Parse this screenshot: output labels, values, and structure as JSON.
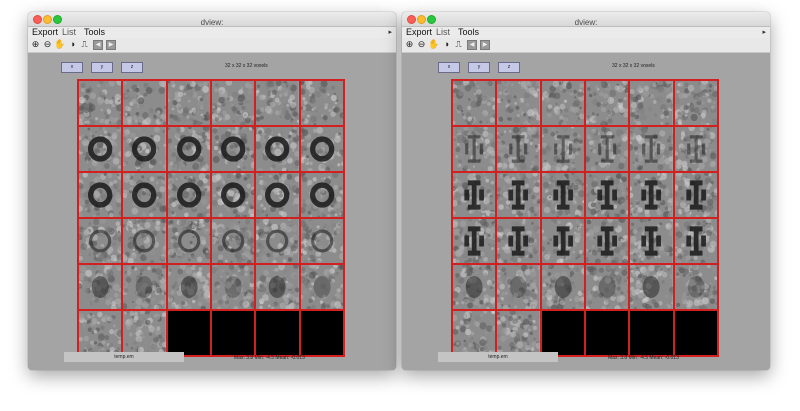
{
  "windows": [
    {
      "title": "dview:",
      "menu": [
        "Export",
        "List",
        "Tools"
      ],
      "menu_arrow": "▸",
      "tools": [
        "zoom-in-icon",
        "zoom-out-icon",
        "hand-icon",
        "contrast-icon",
        "step-icon",
        "back-icon",
        "forward-icon"
      ],
      "axis_buttons": [
        "x",
        "y",
        "z"
      ],
      "dims_label": "32 x 32 x 32 voxels",
      "grid": {
        "rows": 6,
        "cols": 6,
        "filled": 32
      },
      "file": "temp.em",
      "stats": "Max: 3.8   Min: -4.5   Mean: -0.013"
    },
    {
      "title": "dview:",
      "menu": [
        "Export",
        "List",
        "Tools"
      ],
      "menu_arrow": "▸",
      "tools": [
        "zoom-in-icon",
        "zoom-out-icon",
        "hand-icon",
        "contrast-icon",
        "step-icon",
        "back-icon",
        "forward-icon"
      ],
      "axis_buttons": [
        "x",
        "y",
        "z"
      ],
      "dims_label": "32 x 32 x 32 voxels",
      "grid": {
        "rows": 6,
        "cols": 6,
        "filled": 32
      },
      "file": "temp.em",
      "stats": "Max: 3.8   Min: -4.5   Mean: -0.013"
    }
  ],
  "colors": {
    "grid_border": "#d21f1f",
    "background": "#a4a4a4",
    "empty_cell": "#000000"
  }
}
